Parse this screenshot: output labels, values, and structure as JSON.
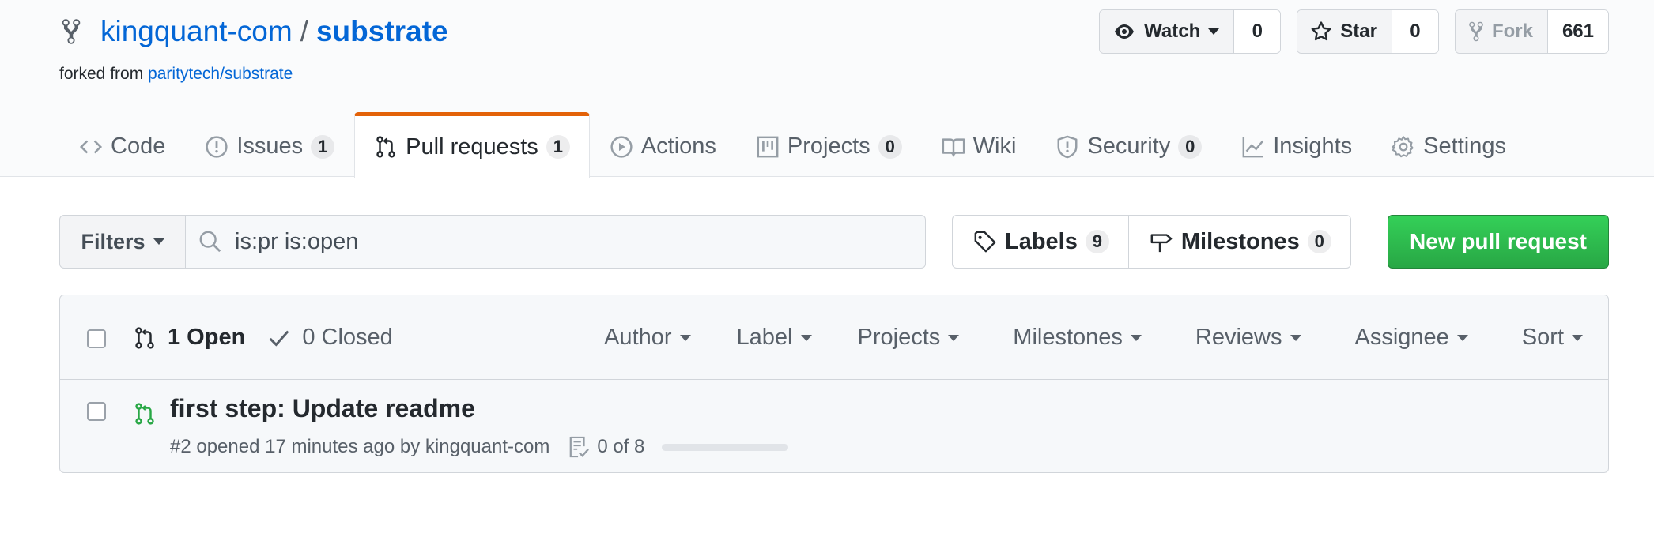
{
  "repo": {
    "owner": "kingquant-com",
    "separator": "/",
    "name": "substrate",
    "forked_from_label": "forked from",
    "forked_from_link": "paritytech/substrate"
  },
  "actions": {
    "watch": {
      "label": "Watch",
      "count": "0"
    },
    "star": {
      "label": "Star",
      "count": "0"
    },
    "fork": {
      "label": "Fork",
      "count": "661"
    }
  },
  "tabs": [
    {
      "label": "Code",
      "icon": "code-icon",
      "counter": null,
      "selected": false
    },
    {
      "label": "Issues",
      "icon": "issue-opened-icon",
      "counter": "1",
      "selected": false
    },
    {
      "label": "Pull requests",
      "icon": "git-pull-request-icon",
      "counter": "1",
      "selected": true
    },
    {
      "label": "Actions",
      "icon": "play-icon",
      "counter": null,
      "selected": false
    },
    {
      "label": "Projects",
      "icon": "project-icon",
      "counter": "0",
      "selected": false
    },
    {
      "label": "Wiki",
      "icon": "book-icon",
      "counter": null,
      "selected": false
    },
    {
      "label": "Security",
      "icon": "shield-icon",
      "counter": "0",
      "selected": false
    },
    {
      "label": "Insights",
      "icon": "graph-icon",
      "counter": null,
      "selected": false
    },
    {
      "label": "Settings",
      "icon": "gear-icon",
      "counter": null,
      "selected": false
    }
  ],
  "subnav": {
    "filters_label": "Filters",
    "search_value": "is:pr is:open",
    "labels_label": "Labels",
    "labels_count": "9",
    "milestones_label": "Milestones",
    "milestones_count": "0",
    "new_pr_label": "New pull request"
  },
  "list_header": {
    "open_label": "1 Open",
    "closed_label": "0 Closed",
    "filters": [
      "Author",
      "Label",
      "Projects",
      "Milestones",
      "Reviews",
      "Assignee",
      "Sort"
    ]
  },
  "pull_requests": [
    {
      "title": "first step: Update readme",
      "meta": "#2 opened 17 minutes ago by kingquant-com",
      "tasks": "0 of 8",
      "tasks_done_fraction": 0
    }
  ],
  "colors": {
    "link": "#0366d6",
    "tab_active_border": "#e36209",
    "primary_button": "#28a745",
    "open_icon": "#28a745"
  }
}
